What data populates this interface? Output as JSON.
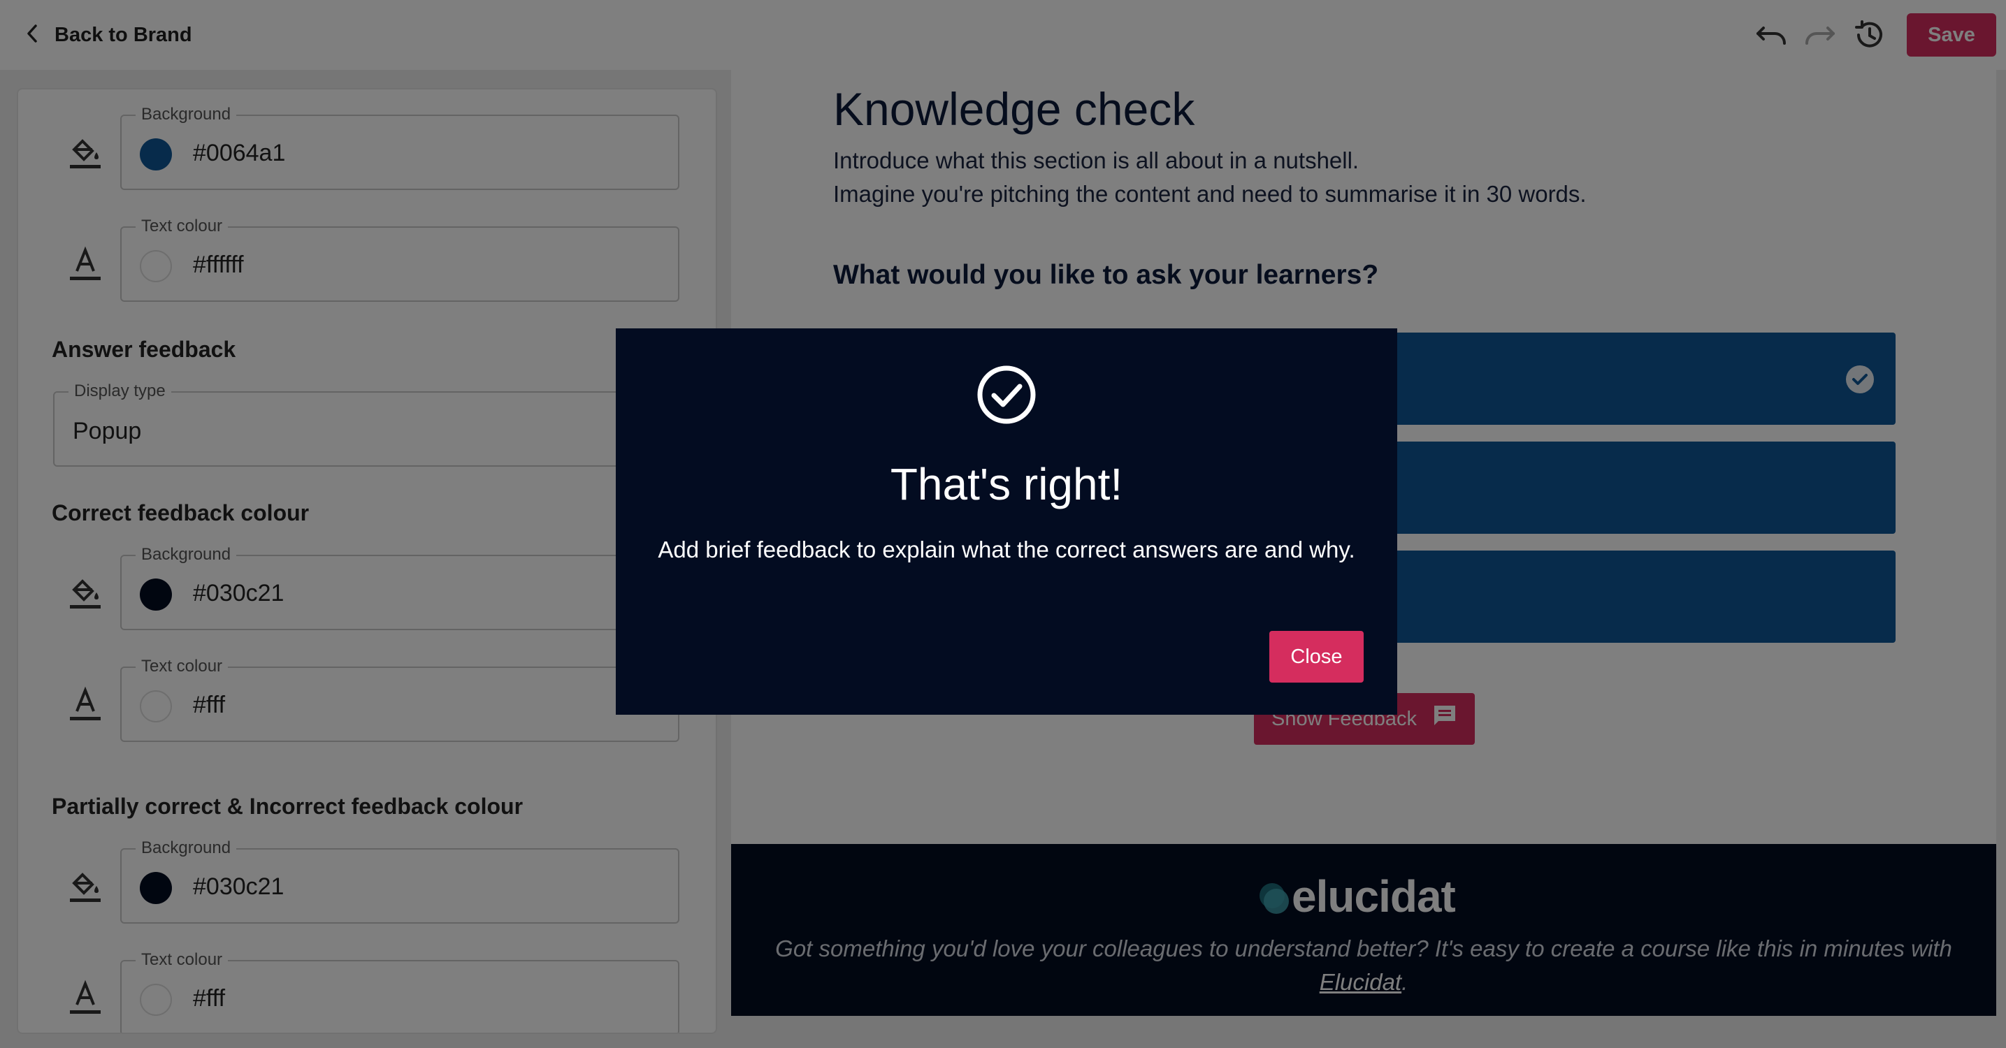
{
  "topbar": {
    "back_label": "Back to Brand",
    "save_label": "Save"
  },
  "left_panel": {
    "top_background": {
      "label": "Background",
      "value": "#0064a1",
      "color": "#0f5796"
    },
    "top_text": {
      "label": "Text colour",
      "value": "#ffffff",
      "color": "#ffffff"
    },
    "answer_feedback": {
      "title": "Answer feedback",
      "display_type_label": "Display type",
      "display_type_value": "Popup"
    },
    "correct": {
      "title": "Correct feedback colour",
      "background": {
        "label": "Background",
        "value": "#030c21",
        "color": "#030c21"
      },
      "text": {
        "label": "Text colour",
        "value": "#fff",
        "color": "#ffffff"
      }
    },
    "partial": {
      "title": "Partially correct & Incorrect feedback colour",
      "background": {
        "label": "Background",
        "value": "#030c21",
        "color": "#030c21"
      },
      "text": {
        "label": "Text colour",
        "value": "#fff",
        "color": "#ffffff"
      }
    }
  },
  "preview": {
    "title": "Knowledge check",
    "intro_line1": "Introduce what this section is all about in a nutshell.",
    "intro_line2": "Imagine you're pitching the content and need to summarise it in 30 words.",
    "question": "What would you like to ask your learners?",
    "show_feedback_label": "Show Feedback",
    "footer": {
      "logo_text": "elucidat",
      "text_before": "Got something you'd love your colleagues to understand better? It's easy to create a course like this in minutes with ",
      "link_text": "Elucidat",
      "text_after": "."
    }
  },
  "modal": {
    "title": "That's right!",
    "body": "Add brief feedback to explain what the correct answers are and why.",
    "close_label": "Close"
  },
  "colors": {
    "accent": "#d52d5e",
    "option_blue": "#0f5796",
    "dark_navy": "#030c21"
  }
}
